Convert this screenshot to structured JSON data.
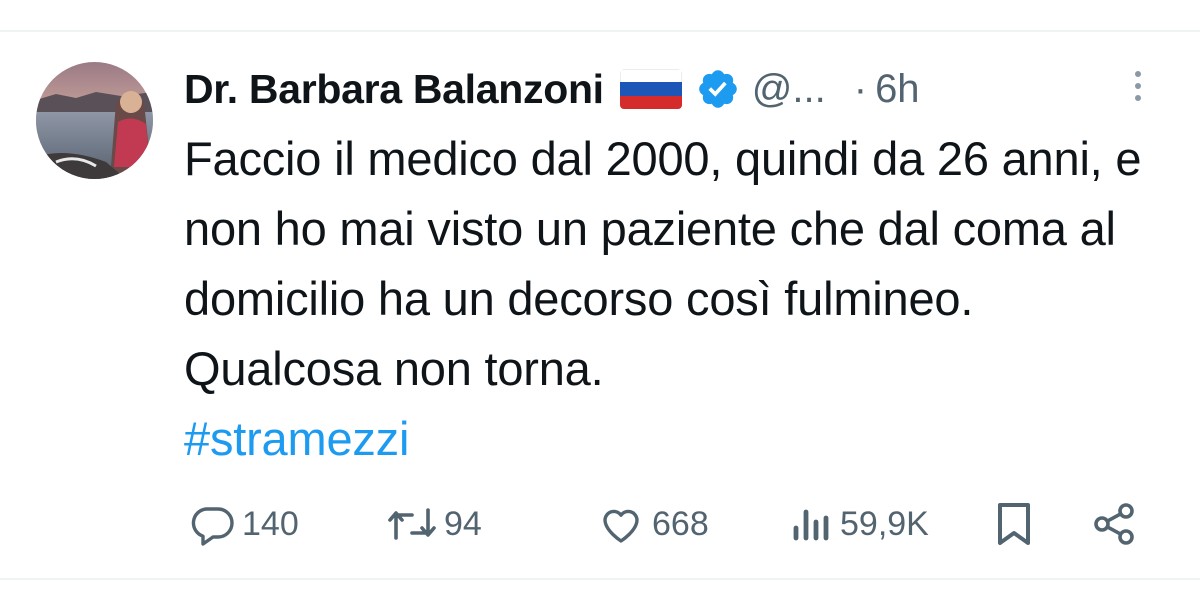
{
  "tweet": {
    "author": {
      "name": "Dr. Barbara Balanzoni",
      "flag_icon": "russian-flag-icon",
      "verified_icon": "verified-badge-icon",
      "handle": "@...",
      "separator": "·",
      "time": "6h"
    },
    "text": "Faccio il medico dal 2000, quindi da 26 anni, e non ho mai visto un paziente che dal coma al domicilio ha un decorso così fulmineo. Qualcosa non torna.",
    "hashtag": "#stramezzi",
    "actions": {
      "replies": "140",
      "retweets": "94",
      "likes": "668",
      "views": "59,9K"
    }
  },
  "colors": {
    "text": "#0f1419",
    "secondary": "#536471",
    "link": "#1d9bf0",
    "verified": "#1d9bf0",
    "divider": "#eff3f4"
  }
}
